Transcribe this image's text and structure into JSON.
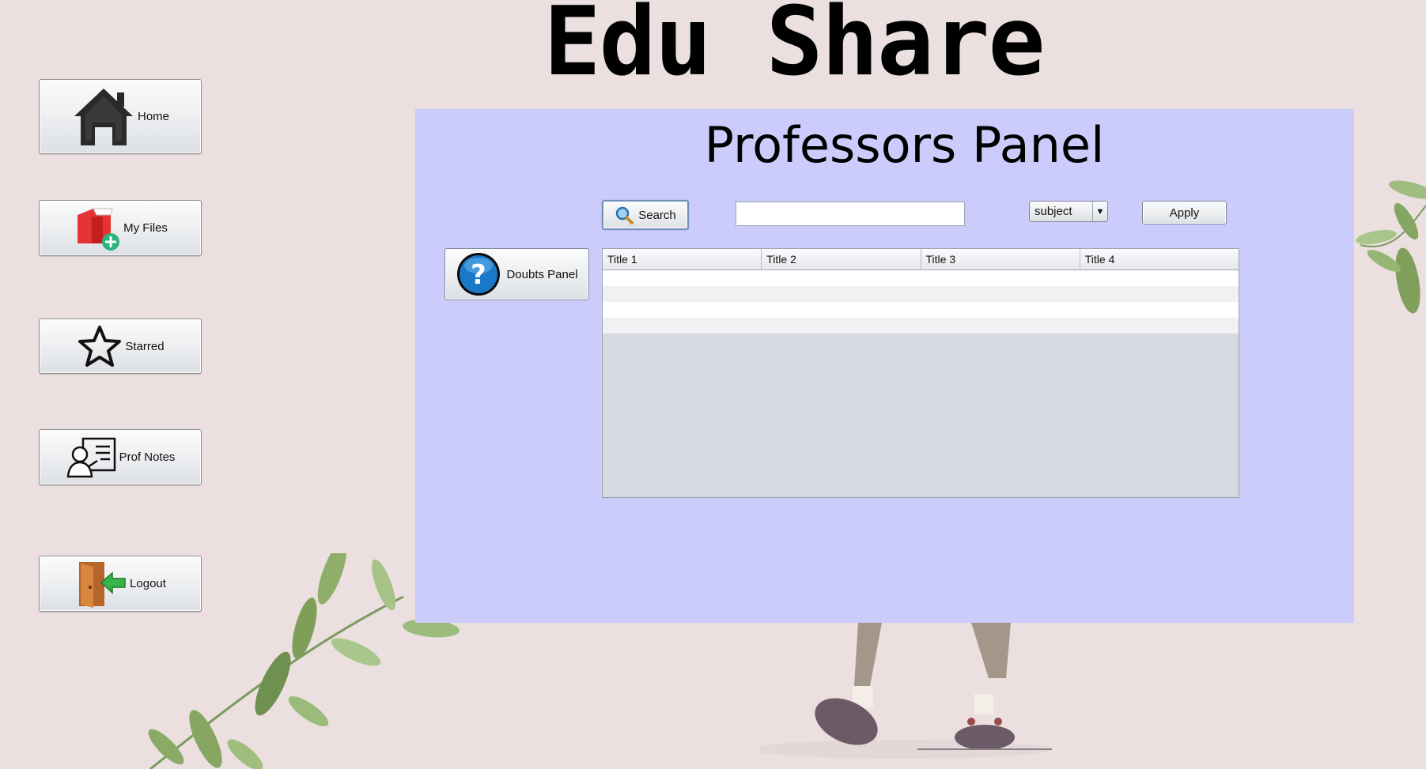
{
  "app": {
    "title": "Edu Share"
  },
  "sidebar": {
    "items": [
      {
        "label": "Home",
        "icon": "home-icon"
      },
      {
        "label": "My Files",
        "icon": "add-folder-icon"
      },
      {
        "label": "Starred",
        "icon": "star-icon"
      },
      {
        "label": "Prof Notes",
        "icon": "professor-notes-icon"
      },
      {
        "label": "Logout",
        "icon": "logout-door-icon"
      }
    ]
  },
  "panel": {
    "title": "Professors Panel",
    "search_label": "Search",
    "search_value": "",
    "filter_selected": "subject",
    "apply_label": "Apply",
    "doubts_label": "Doubts Panel"
  },
  "table": {
    "columns": [
      "Title 1",
      "Title 2",
      "Title 3",
      "Title 4"
    ],
    "rows": 4
  },
  "colors": {
    "background": "#ecdfdf",
    "panel": "#ccccfc",
    "button_face": "#eef0f2"
  }
}
